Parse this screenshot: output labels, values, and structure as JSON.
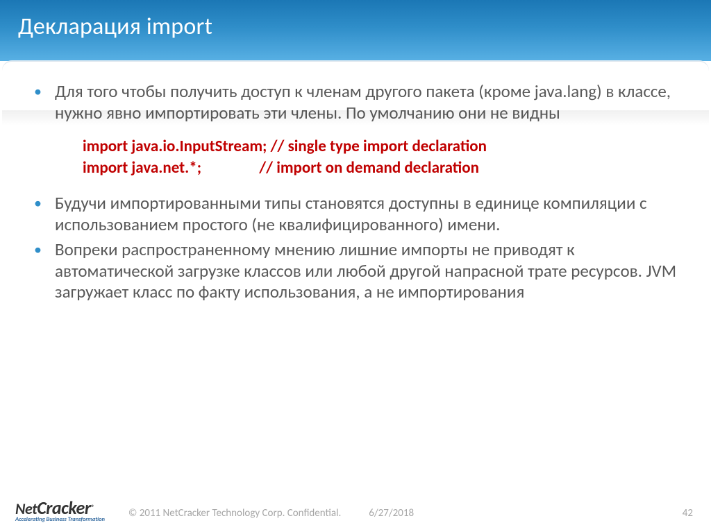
{
  "title": "Декларация import",
  "bullets": {
    "b1": "Для того чтобы получить доступ к членам другого пакета (кроме java.lang) в классе, нужно явно импортировать эти члены. По умолчанию они не видны",
    "b2": "Будучи импортированными типы становятся доступны в единице компиляции с использованием простого (не квалифицированного) имени.",
    "b3": "Вопреки распространенному мнению лишние импорты не приводят к автоматической загрузке классов или любой другой напрасной трате ресурсов. JVM загружает класс по факту использования, а не импортирования"
  },
  "code": {
    "line1": "import java.io.InputStream; // single type import declaration",
    "line2": "import java.net.*;                // import on demand declaration"
  },
  "footer": {
    "logo_main_a": "Net",
    "logo_main_b": "Cracker",
    "logo_reg": "®",
    "logo_sub": "Accelerating Business Transformation",
    "copyright": "© 2011 NetCracker Technology Corp. Confidential.",
    "date": "6/27/2018",
    "page": "42"
  }
}
